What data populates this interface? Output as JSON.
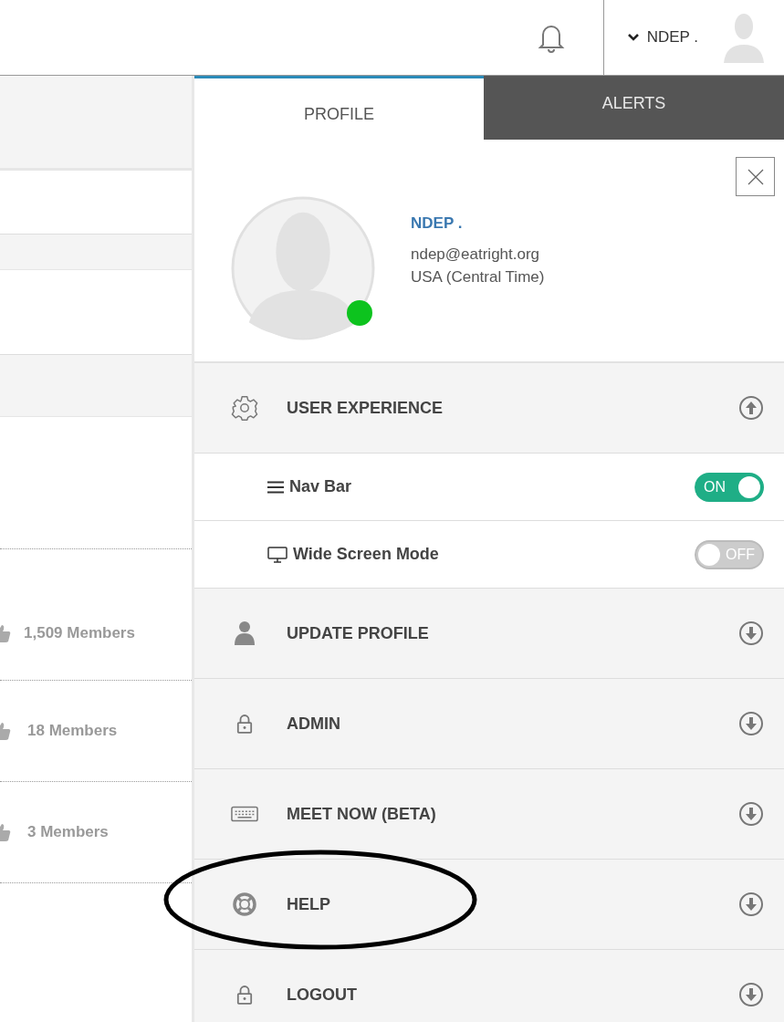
{
  "header": {
    "user_name": "NDEP ."
  },
  "background_list": [
    {
      "members": "1,509 Members"
    },
    {
      "members": "18 Members"
    },
    {
      "members": "3 Members"
    }
  ],
  "tabs": [
    {
      "label": "PROFILE",
      "selected": true
    },
    {
      "label": "ALERTS",
      "selected": false
    }
  ],
  "profile": {
    "name": "NDEP .",
    "email": "ndep@eatright.org",
    "timezone": "USA (Central Time)",
    "online": true
  },
  "menu": [
    {
      "kind": "gear",
      "label": "USER EXPERIENCE",
      "expanded": true,
      "highlighted": false,
      "children": [
        {
          "kind": "menu",
          "label": "Nav Bar",
          "on": true,
          "toggle_text": "ON"
        },
        {
          "kind": "monitor",
          "label": "Wide Screen Mode",
          "on": false,
          "toggle_text": "OFF"
        }
      ]
    },
    {
      "kind": "person",
      "label": "UPDATE PROFILE",
      "expanded": false,
      "highlighted": false
    },
    {
      "kind": "lock",
      "label": "ADMIN",
      "expanded": false,
      "highlighted": false
    },
    {
      "kind": "keyboard",
      "label": "MEET NOW (BETA)",
      "expanded": false,
      "highlighted": false
    },
    {
      "kind": "lifebuoy",
      "label": "HELP",
      "expanded": false,
      "highlighted": true
    },
    {
      "kind": "lock",
      "label": "LOGOUT",
      "expanded": false,
      "highlighted": false
    }
  ]
}
